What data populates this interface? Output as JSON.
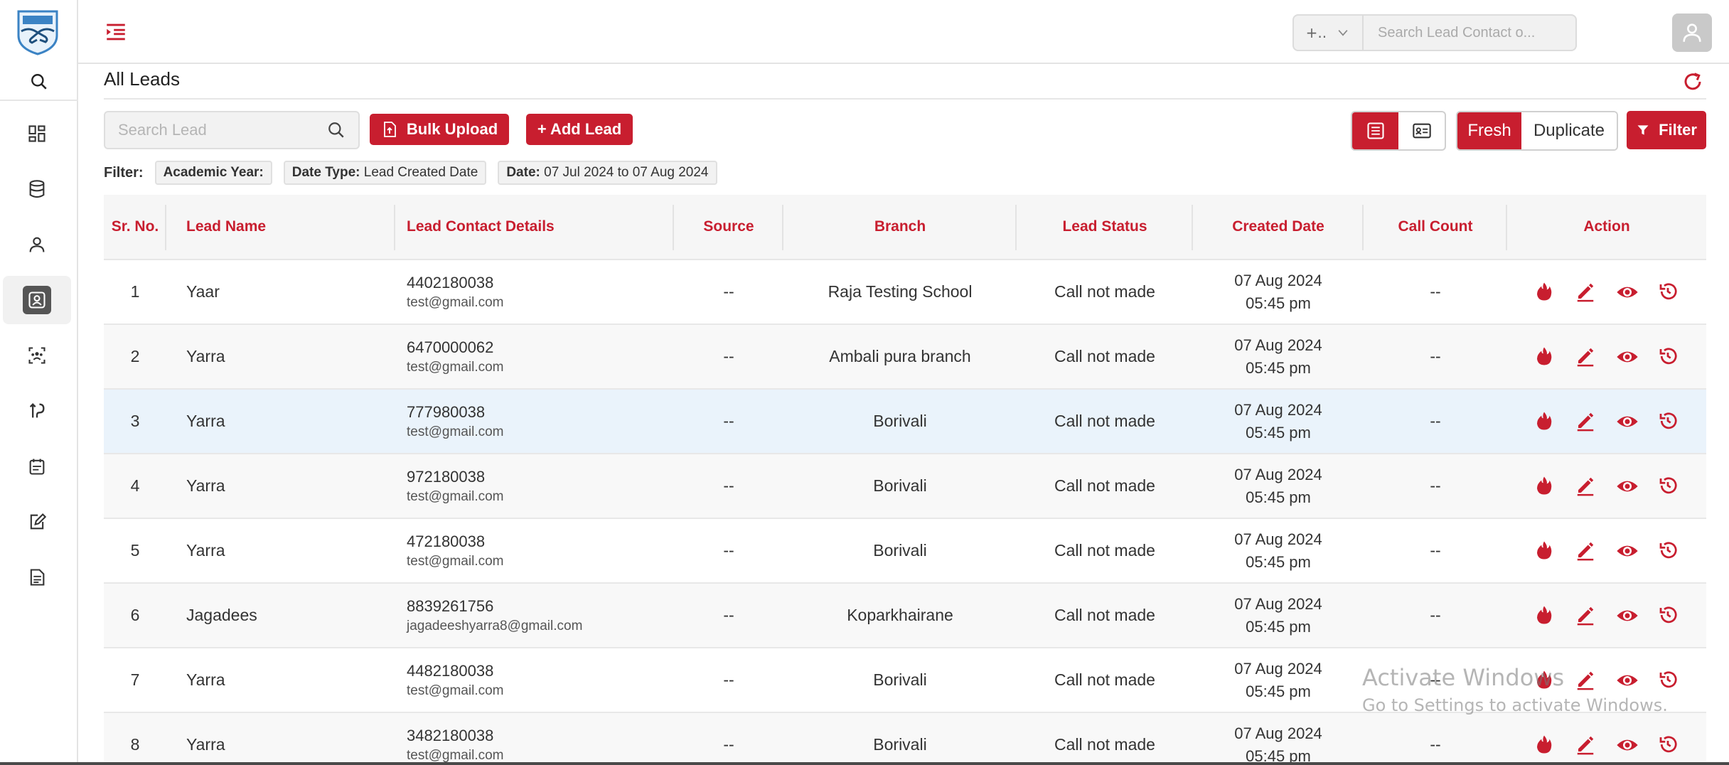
{
  "topbar": {
    "select_value": "+..",
    "search_placeholder": "Search Lead Contact o..."
  },
  "page": {
    "title": "All Leads",
    "search_placeholder": "Search Lead",
    "bulk_upload_label": "Bulk Upload",
    "add_lead_label": "+ Add Lead",
    "fresh_label": "Fresh",
    "duplicate_label": "Duplicate",
    "filter_label": "Filter"
  },
  "filters": {
    "label": "Filter:",
    "academic_year_key": "Academic Year:",
    "date_type_key": "Date Type:",
    "date_type_value": "Lead Created Date",
    "date_key": "Date:",
    "date_value": "07 Jul 2024 to 07 Aug 2024"
  },
  "table": {
    "headers": {
      "sr": "Sr. No.",
      "name": "Lead Name",
      "contact": "Lead Contact Details",
      "source": "Source",
      "branch": "Branch",
      "status": "Lead Status",
      "created": "Created Date",
      "count": "Call Count",
      "action": "Action"
    },
    "rows": [
      {
        "sr": "1",
        "name": "Yaar",
        "phone": "4402180038",
        "email": "test@gmail.com",
        "source": "--",
        "branch": "Raja Testing School",
        "status": "Call not made",
        "date": "07 Aug 2024",
        "time": "05:45 pm",
        "count": "--"
      },
      {
        "sr": "2",
        "name": "Yarra",
        "phone": "6470000062",
        "email": "test@gmail.com",
        "source": "--",
        "branch": "Ambali pura branch",
        "status": "Call not made",
        "date": "07 Aug 2024",
        "time": "05:45 pm",
        "count": "--"
      },
      {
        "sr": "3",
        "name": "Yarra",
        "phone": "777980038",
        "email": "test@gmail.com",
        "source": "--",
        "branch": "Borivali",
        "status": "Call not made",
        "date": "07 Aug 2024",
        "time": "05:45 pm",
        "count": "--"
      },
      {
        "sr": "4",
        "name": "Yarra",
        "phone": "972180038",
        "email": "test@gmail.com",
        "source": "--",
        "branch": "Borivali",
        "status": "Call not made",
        "date": "07 Aug 2024",
        "time": "05:45 pm",
        "count": "--"
      },
      {
        "sr": "5",
        "name": "Yarra",
        "phone": "472180038",
        "email": "test@gmail.com",
        "source": "--",
        "branch": "Borivali",
        "status": "Call not made",
        "date": "07 Aug 2024",
        "time": "05:45 pm",
        "count": "--"
      },
      {
        "sr": "6",
        "name": "Jagadees",
        "phone": "8839261756",
        "email": "jagadeeshyarra8@gmail.com",
        "source": "--",
        "branch": "Koparkhairane",
        "status": "Call not made",
        "date": "07 Aug 2024",
        "time": "05:45 pm",
        "count": "--"
      },
      {
        "sr": "7",
        "name": "Yarra",
        "phone": "4482180038",
        "email": "test@gmail.com",
        "source": "--",
        "branch": "Borivali",
        "status": "Call not made",
        "date": "07 Aug 2024",
        "time": "05:45 pm",
        "count": "--"
      },
      {
        "sr": "8",
        "name": "Yarra",
        "phone": "3482180038",
        "email": "test@gmail.com",
        "source": "--",
        "branch": "Borivali",
        "status": "Call not made",
        "date": "07 Aug 2024",
        "time": "05:45 pm",
        "count": "--"
      }
    ]
  },
  "watermark": {
    "line1": "Activate Windows",
    "line2": "Go to Settings to activate Windows."
  },
  "colors": {
    "accent": "#c81e2f",
    "highlight_row": "#eaf3fb"
  }
}
